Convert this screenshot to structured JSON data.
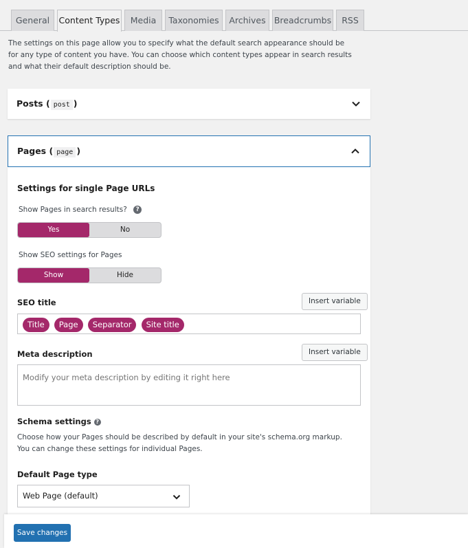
{
  "tabs": [
    {
      "label": "General",
      "active": false
    },
    {
      "label": "Content Types",
      "active": true
    },
    {
      "label": "Media",
      "active": false
    },
    {
      "label": "Taxonomies",
      "active": false
    },
    {
      "label": "Archives",
      "active": false
    },
    {
      "label": "Breadcrumbs",
      "active": false
    },
    {
      "label": "RSS",
      "active": false
    }
  ],
  "intro": "The settings on this page allow you to specify what the default search appearance should be for any type of content you have. You can choose which content types appear in search results and what their default description should be.",
  "posts": {
    "title": "Posts",
    "slug": "post",
    "open_paren": "(",
    "close_paren": ")"
  },
  "pages": {
    "title": "Pages",
    "slug": "page",
    "open_paren": "(",
    "close_paren": ")",
    "single_heading": "Settings for single Page URLs",
    "show_in_search": {
      "label": "Show Pages in search results?",
      "options": [
        "Yes",
        "No"
      ],
      "selected": "Yes"
    },
    "show_seo": {
      "label": "Show SEO settings for Pages",
      "options": [
        "Show",
        "Hide"
      ],
      "selected": "Show"
    },
    "seo_title": {
      "label": "SEO title",
      "insert_button": "Insert variable",
      "variables": [
        "Title",
        "Page",
        "Separator",
        "Site title"
      ]
    },
    "meta_description": {
      "label": "Meta description",
      "insert_button": "Insert variable",
      "placeholder": "Modify your meta description by editing it right here"
    },
    "schema": {
      "heading": "Schema settings",
      "description": "Choose how your Pages should be described by default in your site's schema.org markup. You can change these settings for individual Pages.",
      "default_type_label": "Default Page type",
      "default_type_value": "Web Page (default)"
    }
  },
  "footer": {
    "save_label": "Save changes"
  },
  "colors": {
    "accent": "#a4286a",
    "primary": "#2271b1"
  },
  "icons": {
    "collapse": "chevron-down-icon",
    "expand": "chevron-up-icon",
    "help": "question-icon"
  }
}
